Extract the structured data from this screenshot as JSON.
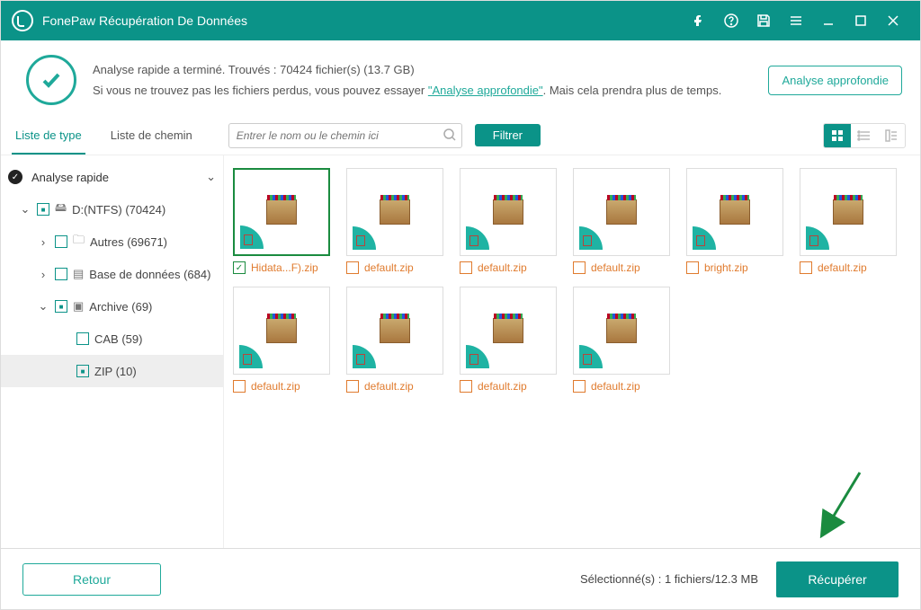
{
  "app": {
    "title": "FonePaw Récupération De Données"
  },
  "status": {
    "line1": "Analyse rapide a terminé. Trouvés : 70424 fichier(s) (13.7 GB)",
    "line2a": "Si vous ne trouvez pas les fichiers perdus, vous pouvez essayer ",
    "deep_link": "\"Analyse approfondie\"",
    "line2b": ". Mais cela prendra plus de temps.",
    "deep_btn": "Analyse approfondie"
  },
  "tabs": {
    "type": "Liste de type",
    "path": "Liste de chemin"
  },
  "search": {
    "placeholder": "Entrer le nom ou le chemin ici"
  },
  "filter_btn": "Filtrer",
  "sidebar": {
    "summary": "Analyse rapide",
    "drive": "D:(NTFS) (70424)",
    "others": "Autres (69671)",
    "db": "Base de données (684)",
    "archive": "Archive (69)",
    "cab": "CAB (59)",
    "zip": "ZIP (10)"
  },
  "files": [
    {
      "name": "Hidata...F).zip",
      "selected": true
    },
    {
      "name": "default.zip",
      "selected": false
    },
    {
      "name": "default.zip",
      "selected": false
    },
    {
      "name": "default.zip",
      "selected": false
    },
    {
      "name": "bright.zip",
      "selected": false
    },
    {
      "name": "default.zip",
      "selected": false
    },
    {
      "name": "default.zip",
      "selected": false
    },
    {
      "name": "default.zip",
      "selected": false
    },
    {
      "name": "default.zip",
      "selected": false
    },
    {
      "name": "default.zip",
      "selected": false
    }
  ],
  "footer": {
    "back": "Retour",
    "selection": "Sélectionné(s) : 1 fichiers/12.3 MB",
    "recover": "Récupérer"
  }
}
